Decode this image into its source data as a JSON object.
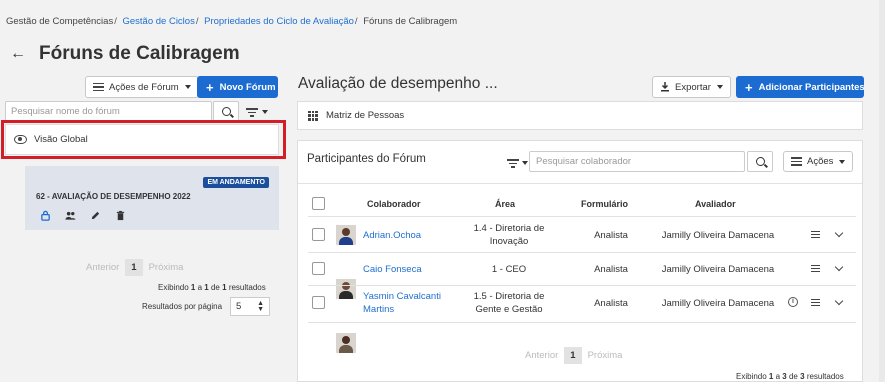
{
  "breadcrumb": {
    "root": "Gestão de Competências",
    "level1": "Gestão de Ciclos",
    "level2": "Propriedades do Ciclo de Avaliação",
    "current": "Fóruns de Calibragem"
  },
  "page": {
    "title": "Fóruns de Calibragem"
  },
  "left_panel": {
    "forum_actions_label": "Ações de Fórum",
    "new_forum_label": "Novo Fórum",
    "search_placeholder": "Pesquisar nome do fórum",
    "global_view_label": "Visão Global",
    "forum_card": {
      "status_badge": "EM ANDAMENTO",
      "title": "62 - AVALIAÇÃO DE DESEMPENHO 2022"
    },
    "pagination": {
      "previous": "Anterior",
      "current": "1",
      "next": "Próxima",
      "summary_prefix": "Exibindo",
      "from": "1",
      "a": "a",
      "to": "1",
      "de": "de",
      "total": "1",
      "summary_suffix": "resultados",
      "per_page_label": "Resultados por página",
      "per_page_value": "5"
    }
  },
  "right_panel": {
    "title": "Avaliação de desempenho ...",
    "export_label": "Exportar",
    "add_participants_label": "Adicionar Participantes",
    "people_matrix_label": "Matriz de Pessoas",
    "participants": {
      "title": "Participantes do Fórum",
      "search_placeholder": "Pesquisar colaborador",
      "actions_label": "Ações",
      "columns": [
        "Colaborador",
        "Área",
        "Formulário",
        "Avaliador"
      ],
      "rows": [
        {
          "name": "Adrian.Ochoa",
          "area": "1.4 - Diretoria de Inovação",
          "form": "Analista",
          "evaluator": "Jamilly Oliveira Damacena"
        },
        {
          "name": "Caio Fonseca",
          "area": "1 - CEO",
          "form": "Analista",
          "evaluator": "Jamilly Oliveira Damacena"
        },
        {
          "name": "Yasmin Cavalcanti Martins",
          "area": "1.5 - Diretoria de Gente e Gestão",
          "form": "Analista",
          "evaluator": "Jamilly Oliveira Damacena"
        }
      ],
      "pagination": {
        "previous": "Anterior",
        "current": "1",
        "next": "Próxima",
        "summary_prefix": "Exibindo",
        "from": "1",
        "a": "a",
        "to": "3",
        "de": "de",
        "total": "3",
        "summary_suffix": "resultados"
      }
    }
  },
  "colors": {
    "primary": "#1b6bd1",
    "badge": "#1b4f9c",
    "highlight": "#d31d27",
    "link": "#1f6fd0"
  }
}
